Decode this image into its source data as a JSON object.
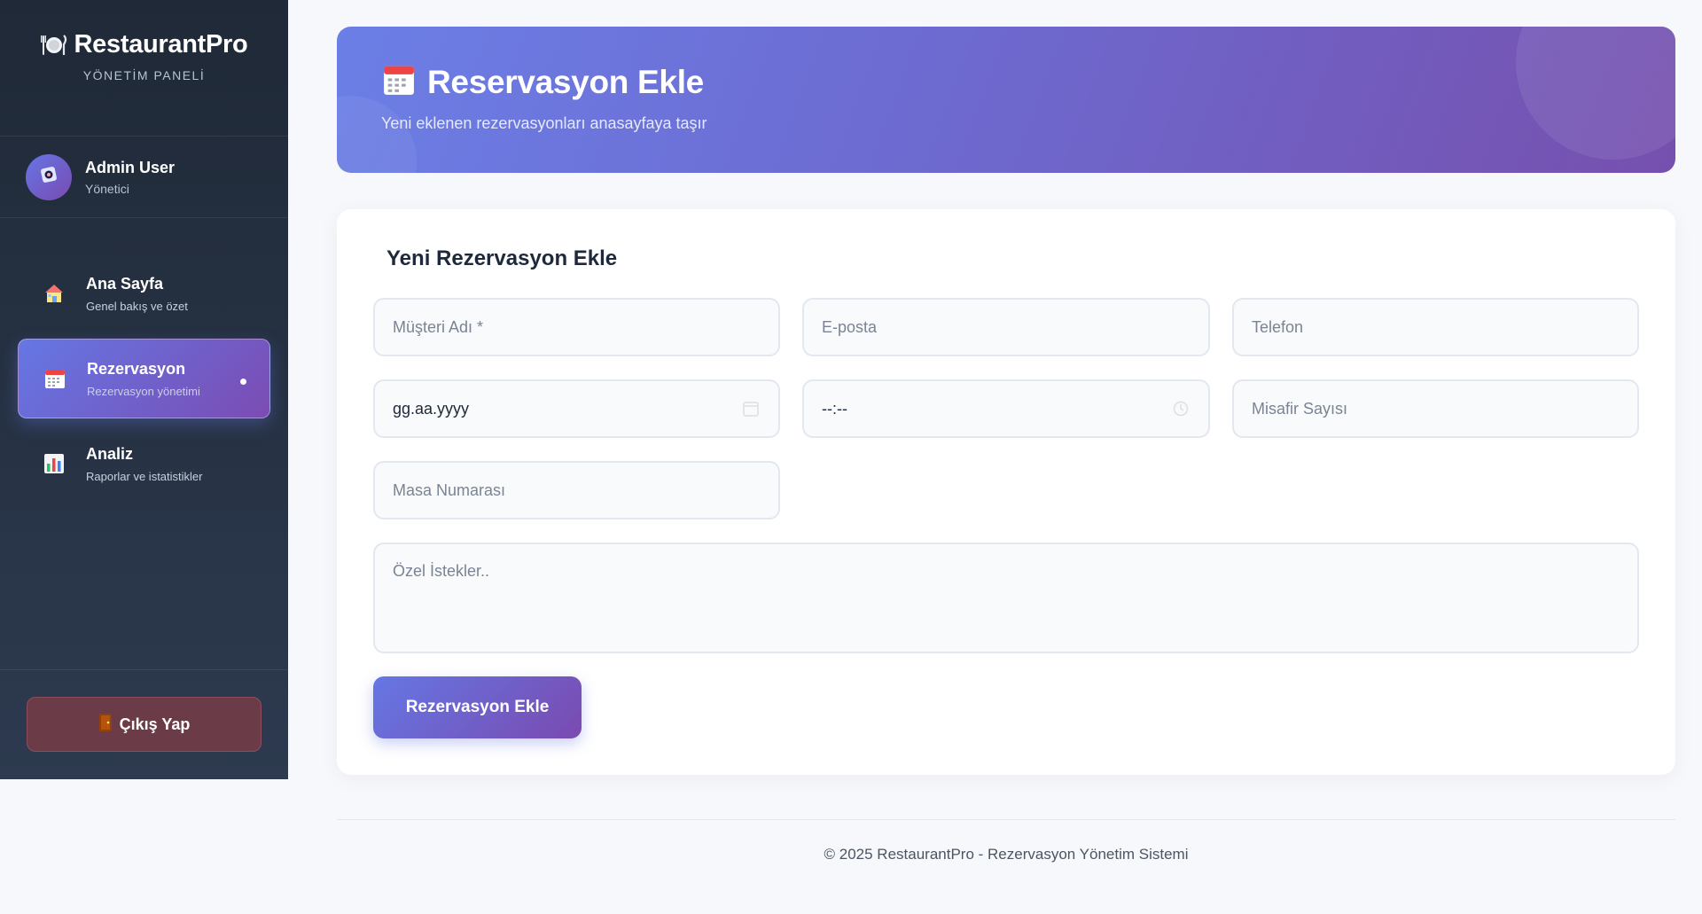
{
  "brand": {
    "name": "RestaurantPro",
    "subtitle": "YÖNETİM PANELİ",
    "icon": "plate-cutlery-icon"
  },
  "user": {
    "name": "Admin User",
    "role": "Yönetici",
    "avatar_icon": "chef-icon"
  },
  "nav": {
    "items": [
      {
        "title": "Ana Sayfa",
        "desc": "Genel bakış ve özet",
        "icon": "house-icon",
        "active": false
      },
      {
        "title": "Rezervasyon",
        "desc": "Rezervasyon yönetimi",
        "icon": "calendar-icon",
        "active": true
      },
      {
        "title": "Analiz",
        "desc": "Raporlar ve istatistikler",
        "icon": "bar-chart-icon",
        "active": false
      }
    ]
  },
  "logout": {
    "label": "Çıkış Yap",
    "icon": "door-icon"
  },
  "hero": {
    "title": "Reservasyon Ekle",
    "subtitle": "Yeni eklenen rezervasyonları anasayfaya taşır",
    "icon": "calendar-icon"
  },
  "form": {
    "title": "Yeni Rezervasyon Ekle",
    "customer_placeholder": "Müşteri Adı *",
    "email_placeholder": "E-posta",
    "phone_placeholder": "Telefon",
    "date_value": "gg.aa.yyyy",
    "time_value": "--:--",
    "guests_placeholder": "Misafir Sayısı",
    "table_placeholder": "Masa Numarası",
    "notes_placeholder": "Özel İstekler..",
    "submit_label": "Rezervasyon Ekle"
  },
  "footer": {
    "text": "© 2025 RestaurantPro - Rezervasyon Yönetim Sistemi"
  },
  "colors": {
    "accent_start": "#6577e4",
    "accent_end": "#7a4ab0",
    "sidebar": "#1f2937",
    "logout_bg": "#6b3b47"
  }
}
